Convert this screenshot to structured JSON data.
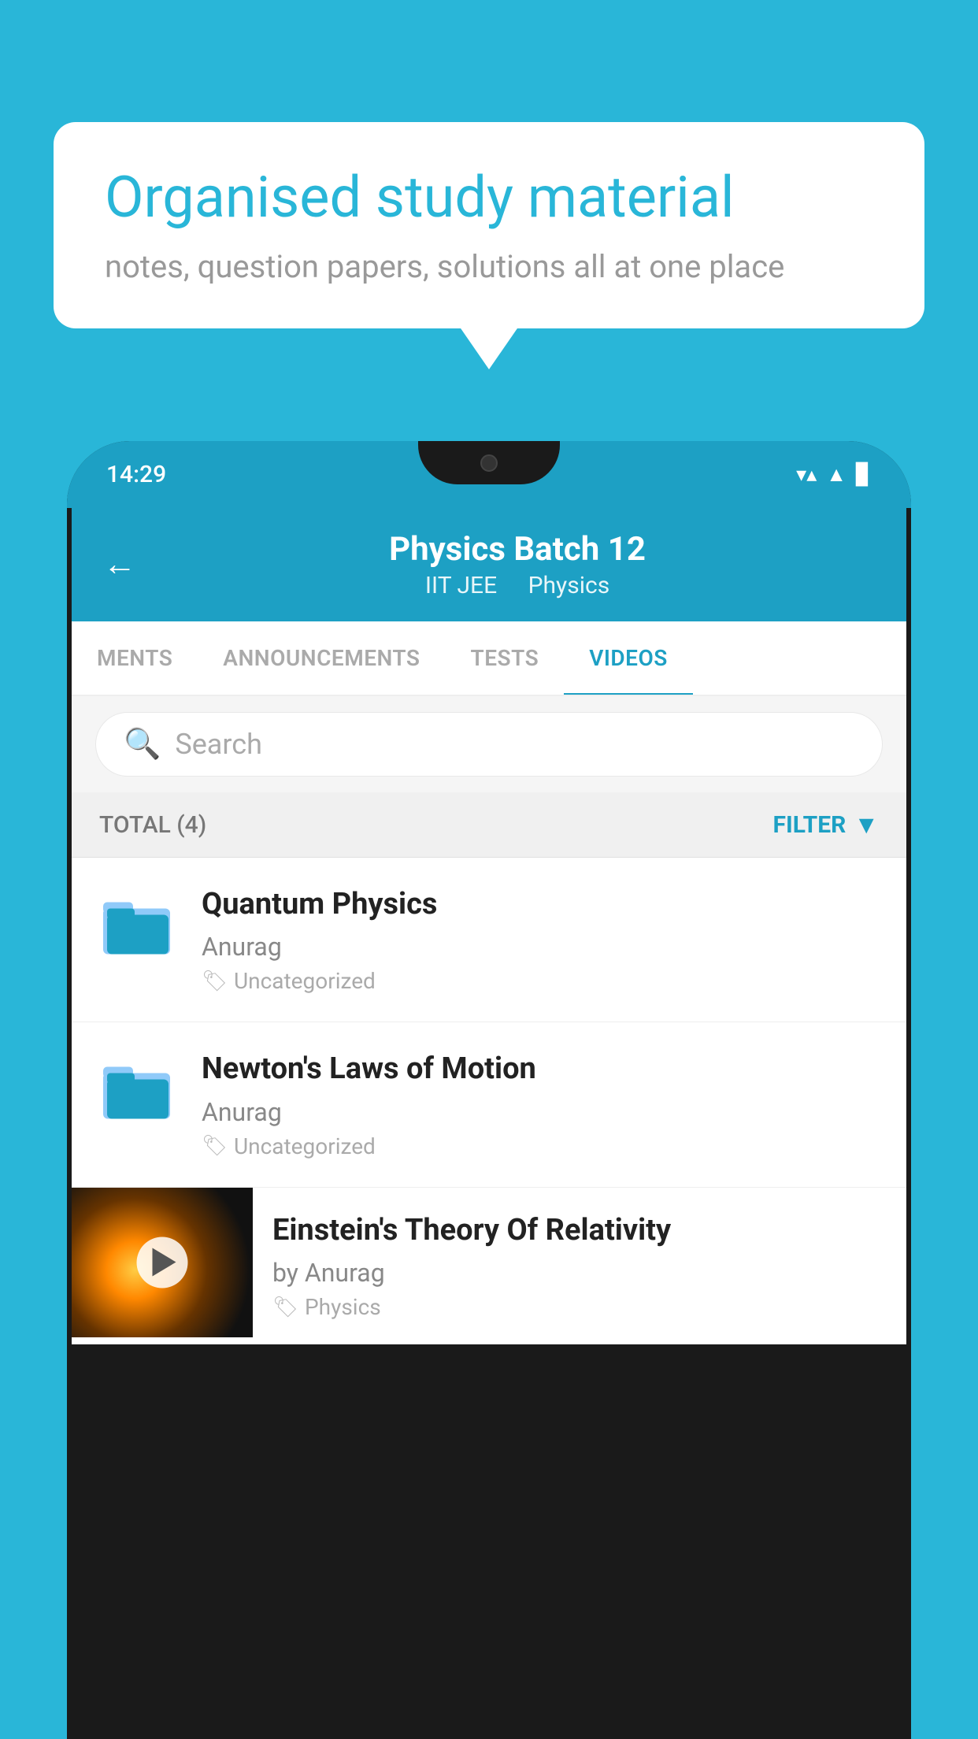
{
  "background_color": "#29B6D8",
  "bubble": {
    "title": "Organised study material",
    "subtitle": "notes, question papers, solutions all at one place"
  },
  "status_bar": {
    "time": "14:29",
    "icons": [
      "wifi",
      "signal",
      "battery"
    ]
  },
  "app_header": {
    "title": "Physics Batch 12",
    "subtitle1": "IIT JEE",
    "subtitle2": "Physics",
    "back_label": "←"
  },
  "tabs": [
    {
      "label": "MENTS",
      "active": false
    },
    {
      "label": "ANNOUNCEMENTS",
      "active": false
    },
    {
      "label": "TESTS",
      "active": false
    },
    {
      "label": "VIDEOS",
      "active": true
    }
  ],
  "search": {
    "placeholder": "Search"
  },
  "filter_bar": {
    "total_label": "TOTAL (4)",
    "filter_label": "FILTER"
  },
  "videos": [
    {
      "id": 1,
      "title": "Quantum Physics",
      "author": "Anurag",
      "tag": "Uncategorized",
      "type": "folder"
    },
    {
      "id": 2,
      "title": "Newton's Laws of Motion",
      "author": "Anurag",
      "tag": "Uncategorized",
      "type": "folder"
    },
    {
      "id": 3,
      "title": "Einstein's Theory Of Relativity",
      "author": "by Anurag",
      "tag": "Physics",
      "type": "video"
    }
  ]
}
